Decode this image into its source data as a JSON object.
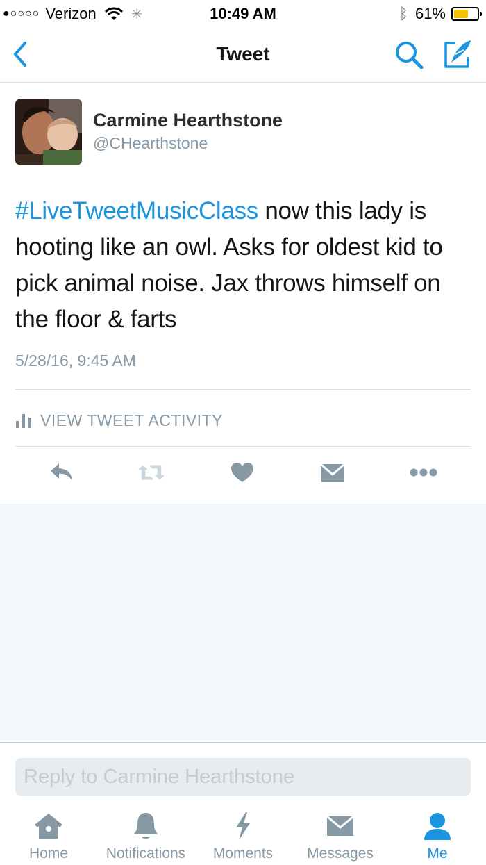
{
  "status_bar": {
    "signal_dots": "●○○○○",
    "carrier": "Verizon",
    "time": "10:49 AM",
    "battery_percent": "61%",
    "battery_level": 0.61
  },
  "nav": {
    "title": "Tweet"
  },
  "tweet": {
    "author_name": "Carmine Hearthstone",
    "author_handle": "@CHearthstone",
    "hashtag": "#LiveTweetMusicClass",
    "body": " now this lady is hooting like an owl. Asks for oldest kid to pick animal noise. Jax throws himself on the floor & farts",
    "timestamp": "5/28/16, 9:45 AM",
    "activity_label": "VIEW TWEET ACTIVITY"
  },
  "reply": {
    "placeholder": "Reply to Carmine Hearthstone"
  },
  "tab_bar": {
    "items": [
      {
        "label": "Home",
        "icon": "home-icon"
      },
      {
        "label": "Notifications",
        "icon": "bell-icon"
      },
      {
        "label": "Moments",
        "icon": "lightning-icon"
      },
      {
        "label": "Messages",
        "icon": "envelope-icon"
      },
      {
        "label": "Me",
        "icon": "person-icon"
      }
    ],
    "active": "Me"
  },
  "colors": {
    "accent": "#1b95e0",
    "icon_gray": "#8899a6",
    "action_gray": "#aab8c2",
    "battery": "#f5c400"
  }
}
